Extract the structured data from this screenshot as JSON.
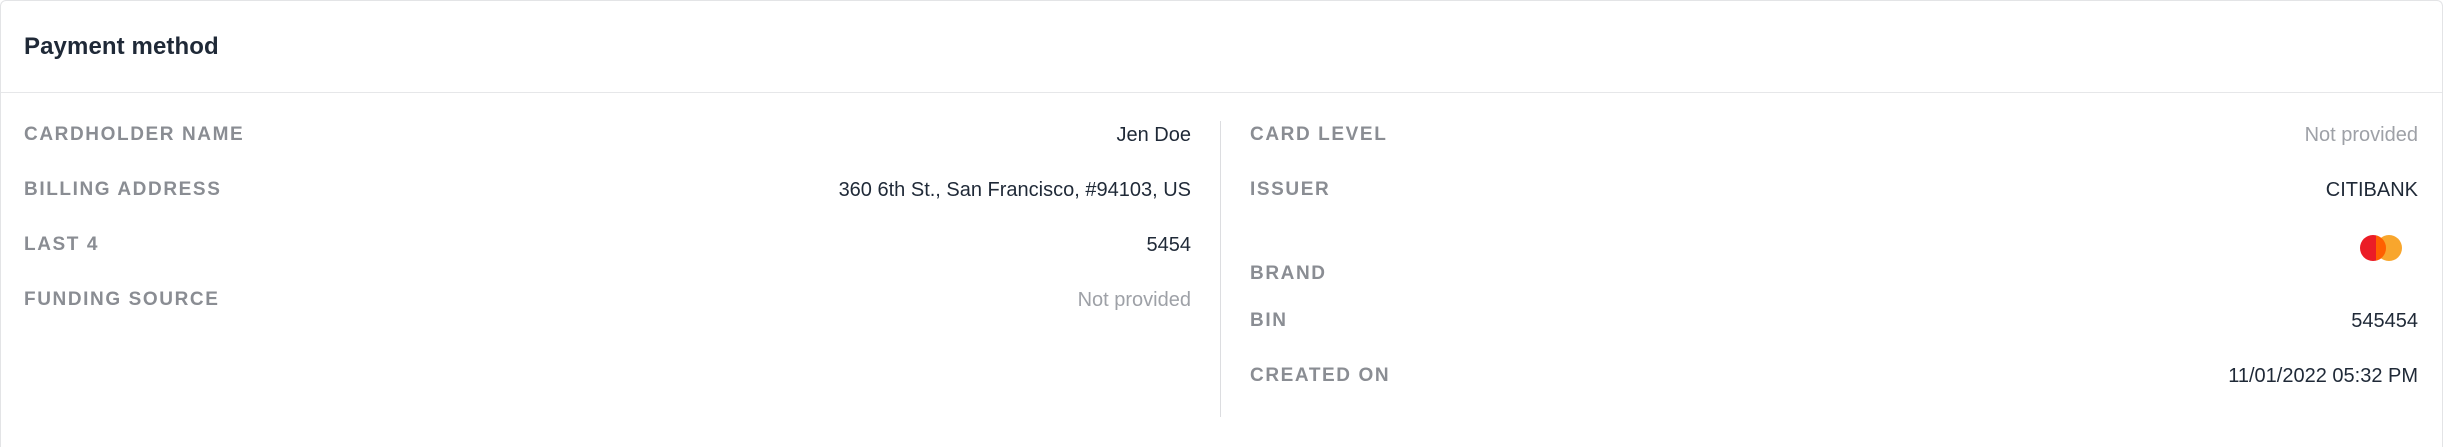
{
  "header": {
    "title": "Payment method"
  },
  "left": {
    "cardholder_name": {
      "label": "CARDHOLDER NAME",
      "value": "Jen Doe"
    },
    "billing_address": {
      "label": "BILLING ADDRESS",
      "value": "360 6th St., San Francisco, #94103, US"
    },
    "last4": {
      "label": "LAST 4",
      "value": "5454"
    },
    "funding_source": {
      "label": "FUNDING SOURCE",
      "value": "Not provided"
    }
  },
  "right": {
    "card_level": {
      "label": "CARD LEVEL",
      "value": "Not provided"
    },
    "issuer": {
      "label": "ISSUER",
      "value": "CITIBANK"
    },
    "brand": {
      "label": "BRAND",
      "icon": "mastercard-logo-icon"
    },
    "bin": {
      "label": "BIN",
      "value": "545454"
    },
    "created_on": {
      "label": "CREATED ON",
      "value": "11/01/2022 05:32 PM"
    }
  },
  "colors": {
    "mastercard_red": "#eb1c26",
    "mastercard_orange": "#f79e1b"
  }
}
